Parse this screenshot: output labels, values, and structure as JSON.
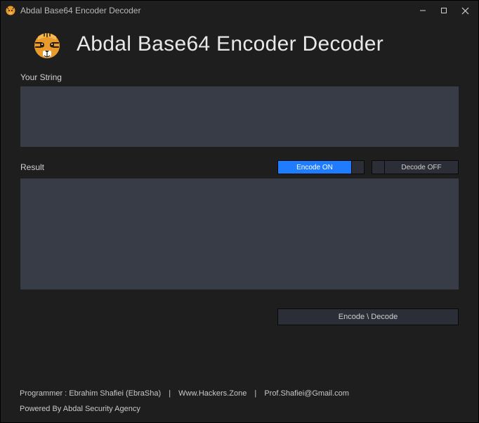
{
  "window": {
    "title": "Abdal Base64 Encoder Decoder"
  },
  "header": {
    "title": "Abdal Base64 Encoder Decoder"
  },
  "input": {
    "label": "Your String",
    "value": ""
  },
  "result": {
    "label": "Result",
    "value": ""
  },
  "toggles": {
    "encode_label": "Encode ON",
    "decode_label": "Decode OFF"
  },
  "action": {
    "button_label": "Encode \\ Decode"
  },
  "footer": {
    "programmer_label": "Programmer : Ebrahim Shafiei (EbraSha)",
    "site": "Www.Hackers.Zone",
    "email": "Prof.Shafiei@Gmail.com",
    "powered": "Powered By Abdal Security Agency"
  },
  "colors": {
    "accent": "#1f7cff",
    "bg": "#1e1e1e",
    "panel": "#383c46"
  }
}
